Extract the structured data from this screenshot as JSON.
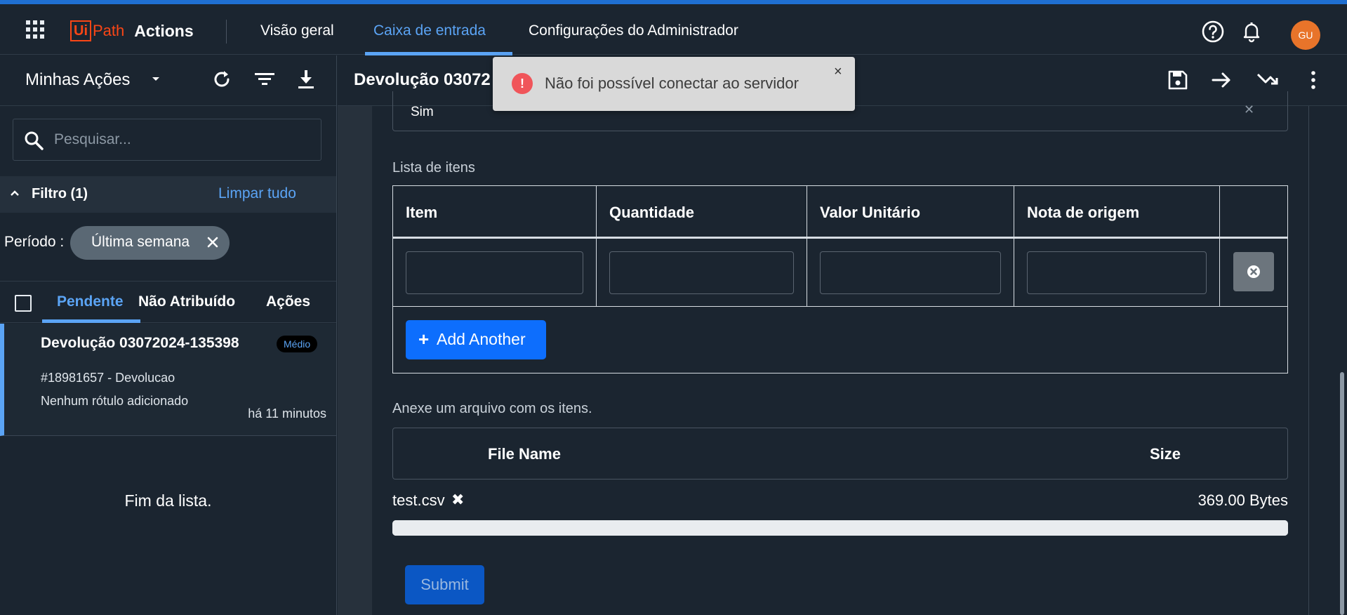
{
  "colors": {
    "accent": "#5ba4f5",
    "brand": "#fa4616",
    "primary_button": "#0d6efd",
    "toast_error": "#f0555a",
    "avatar": "#e8742a"
  },
  "app": {
    "logo_ui": "Ui",
    "logo_path": "Path",
    "logo_actions": "Actions"
  },
  "nav": {
    "tabs": [
      {
        "label": "Visão geral",
        "active": false
      },
      {
        "label": "Caixa de entrada",
        "active": true
      },
      {
        "label": "Configurações do Administrador",
        "active": false
      }
    ],
    "icons": [
      "apps-grid-icon",
      "help-icon",
      "bell-icon"
    ],
    "avatar_initials": "GU"
  },
  "sidebar": {
    "title": "Minhas Ações",
    "icons": [
      "refresh-icon",
      "filter-icon",
      "download-icon"
    ],
    "search_placeholder": "Pesquisar...",
    "filter": {
      "title": "Filtro (1)",
      "clear_label": "Limpar tudo"
    },
    "period": {
      "label": "Período :",
      "chip": "Última semana"
    },
    "tabs": [
      {
        "label": "Pendente",
        "active": true
      },
      {
        "label": "Não Atribuído",
        "active": false
      },
      {
        "label": "Ações",
        "active": false
      }
    ],
    "items": [
      {
        "title": "Devolução 03072024-135398",
        "badge": "Médio",
        "subtitle": "#18981657 - Devolucao",
        "labels": "Nenhum rótulo adicionado",
        "time": "há 11 minutos"
      }
    ],
    "end_of_list": "Fim da lista."
  },
  "main": {
    "title": "Devolução 03072",
    "header_icons": [
      "save-icon",
      "arrow-right-icon",
      "arrow-trend-icon",
      "more-vert-icon"
    ],
    "select_value": "Sim",
    "items_label": "Lista de itens",
    "table": {
      "columns": [
        "Item",
        "Quantidade",
        "Valor Unitário",
        "Nota de origem"
      ],
      "rows": [
        {
          "item": "",
          "quantidade": "",
          "valor_unitario": "",
          "nota_de_origem": ""
        }
      ]
    },
    "add_another_label": "Add Another",
    "attach_label": "Anexe um arquivo com os itens.",
    "files": {
      "columns": [
        "File Name",
        "Size"
      ],
      "rows": [
        {
          "name": "test.csv",
          "size": "369.00 Bytes"
        }
      ],
      "upload_progress": 1.0
    },
    "submit_label": "Submit"
  },
  "toast": {
    "message": "Não foi possível conectar ao servidor",
    "icon": "!",
    "close": "×"
  }
}
